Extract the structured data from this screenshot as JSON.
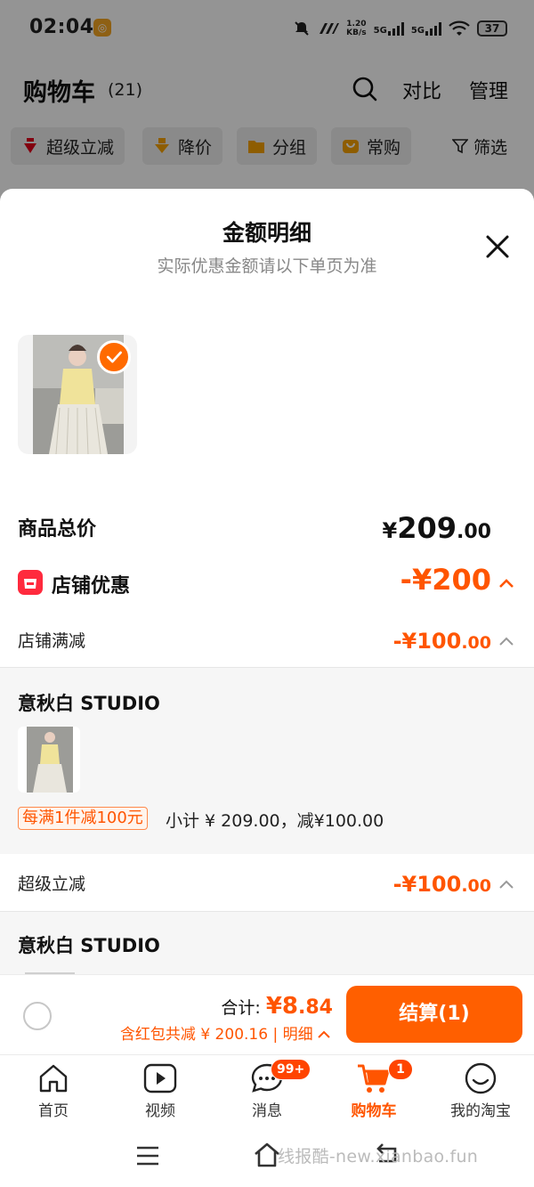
{
  "status_bar": {
    "time": "02:04",
    "speed_top": "1.20",
    "speed_bottom": "KB/s",
    "net1": "5G",
    "net2": "5G",
    "battery": "37"
  },
  "header": {
    "title": "购物车",
    "count": "(21)",
    "compare_label": "对比",
    "manage_label": "管理"
  },
  "filters": [
    {
      "label": "超级立减",
      "icon": "arrow-down-red-icon"
    },
    {
      "label": "降价",
      "icon": "arrow-down-orange-icon"
    },
    {
      "label": "分组",
      "icon": "folder-icon"
    },
    {
      "label": "常购",
      "icon": "bag-icon"
    }
  ],
  "filter_plain": {
    "label": "筛选",
    "icon": "funnel-icon"
  },
  "sheet": {
    "title": "金额明细",
    "subtitle": "实际优惠金额请以下单页为准",
    "total_label": "商品总价",
    "total_currency": "¥",
    "total_int": "209",
    "total_dec": ".00",
    "shop_discount_label": "店铺优惠",
    "shop_discount_value": "-¥200",
    "section1": {
      "label": "店铺满减",
      "value_main": "-¥100",
      "value_dec": ".00",
      "store": "意秋白 STUDIO",
      "promo_tag": "每满1件减100元",
      "promo_desc": "小计 ¥ 209.00，减¥100.00"
    },
    "section2": {
      "label": "超级立减",
      "value_main": "-¥100",
      "value_dec": ".00",
      "store": "意秋白 STUDIO"
    }
  },
  "checkout": {
    "sum_label": "合计: ",
    "sum_currency": "¥",
    "sum_int": "8",
    "sum_dec": ".84",
    "note": "含红包共减 ¥ 200.16 | 明细",
    "pay_label": "结算(1)"
  },
  "tabs": [
    {
      "label": "首页",
      "icon": "home-icon"
    },
    {
      "label": "视频",
      "icon": "video-icon"
    },
    {
      "label": "消息",
      "icon": "chat-icon",
      "badge": "99+"
    },
    {
      "label": "购物车",
      "icon": "cart-icon",
      "badge": "1"
    },
    {
      "label": "我的淘宝",
      "icon": "smile-icon"
    }
  ],
  "watermark": "线报酷-new.xianbao.fun",
  "colors": {
    "accent": "#ff5500",
    "button": "#ff5f00",
    "shop_icon": "#ff2a3d"
  }
}
